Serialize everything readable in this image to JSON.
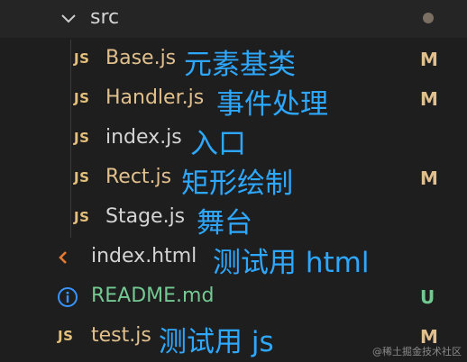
{
  "colors": {
    "background": "#1e1e1e",
    "header_band": "#252526",
    "folder_text": "#d4d4d4",
    "modified": "#e2c08d",
    "untracked": "#73c991",
    "js_icon": "#e5c07b",
    "html_icon": "#e37933",
    "info_icon": "#3794ff",
    "annotation": "#2ea8ff",
    "folder_dot": "#7a6f62"
  },
  "folder": {
    "name": "src",
    "icon": "chevron-down-icon"
  },
  "files": [
    {
      "icon": "js-icon",
      "icon_text": "JS",
      "name": "Base.js",
      "annotation": "元素基类",
      "status": "M"
    },
    {
      "icon": "js-icon",
      "icon_text": "JS",
      "name": "Handler.js",
      "annotation": "事件处理",
      "status": "M"
    },
    {
      "icon": "js-icon",
      "icon_text": "JS",
      "name": "index.js",
      "annotation": "入口",
      "status": ""
    },
    {
      "icon": "js-icon",
      "icon_text": "JS",
      "name": "Rect.js",
      "annotation": "矩形绘制",
      "status": "M"
    },
    {
      "icon": "js-icon",
      "icon_text": "JS",
      "name": "Stage.js",
      "annotation": "舞台",
      "status": ""
    },
    {
      "icon": "html-icon",
      "icon_text": "",
      "name": "index.html",
      "annotation": "测试用 html",
      "status": ""
    },
    {
      "icon": "info-icon",
      "icon_text": "",
      "name": "README.md",
      "annotation": "",
      "status": "U"
    },
    {
      "icon": "js-icon",
      "icon_text": "JS",
      "name": "test.js",
      "annotation": "测试用 js",
      "status": "M"
    }
  ],
  "watermark": "@稀土掘金技术社区"
}
